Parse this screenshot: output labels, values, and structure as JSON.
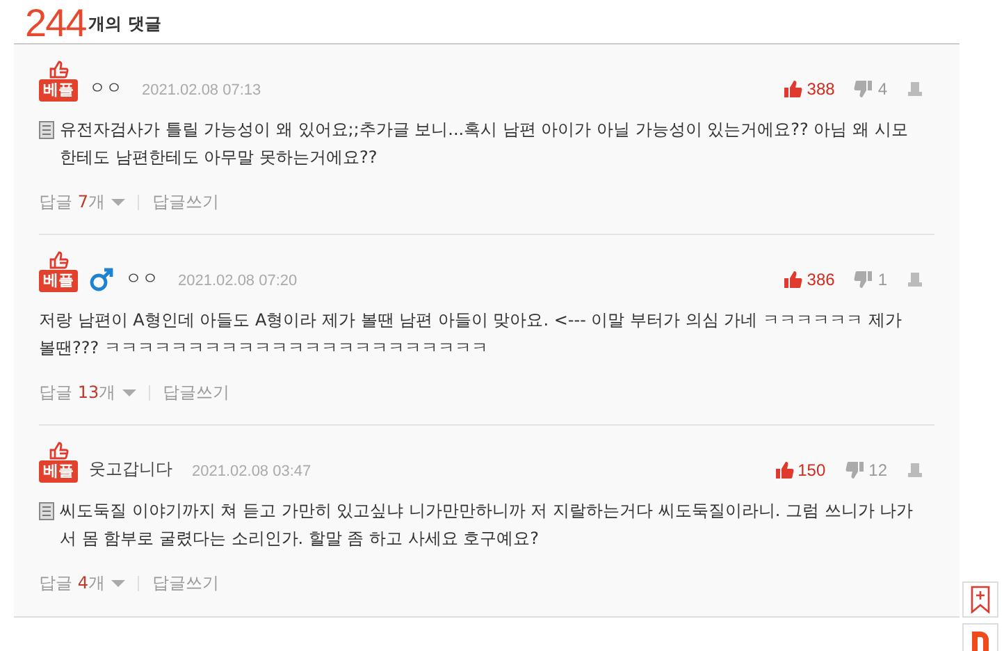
{
  "header": {
    "count": "244",
    "label": "개의 댓글"
  },
  "comments": [
    {
      "badge": "베플",
      "male": false,
      "author": "ㅇㅇ",
      "date": "2021.02.08 07:13",
      "likes": "388",
      "dislikes": "4",
      "memo_icon": true,
      "text": "유전자검사가 틀릴 가능성이 왜 있어요;;추가글 보니...혹시 남편 아이가 아닐 가능성이 있는거에요?? 아님 왜 시모한테도 남편한테도 아무말 못하는거에요??",
      "reply_label": "답글",
      "reply_count": "7",
      "reply_unit": "개",
      "write_label": "답글쓰기"
    },
    {
      "badge": "베플",
      "male": true,
      "author": "ㅇㅇ",
      "date": "2021.02.08 07:20",
      "likes": "386",
      "dislikes": "1",
      "memo_icon": false,
      "text": "저랑 남편이 A형인데 아들도 A형이라 제가 볼땐 남편 아들이 맞아요. <--- 이말 부터가 의심 가네 ㅋㅋㅋㅋㅋㅋ 제가볼땐??? ㅋㅋㅋㅋㅋㅋㅋㅋㅋㅋㅋㅋㅋㅋㅋㅋㅋㅋㅋㅋㅋㅋㅋ",
      "reply_label": "답글",
      "reply_count": "13",
      "reply_unit": "개",
      "write_label": "답글쓰기"
    },
    {
      "badge": "베플",
      "male": false,
      "author": "웃고갑니다",
      "date": "2021.02.08 03:47",
      "likes": "150",
      "dislikes": "12",
      "memo_icon": true,
      "text": "씨도둑질 이야기까지 쳐 듣고 가만히 있고싶냐 니가만만하니까 저 지랄하는거다 씨도둑질이라니. 그럼 쓰니가 나가서 몸 함부로 굴렸다는 소리인가. 할말 좀 하고 사세요 호구예요?",
      "reply_label": "답글",
      "reply_count": "4",
      "reply_unit": "개",
      "write_label": "답글쓰기"
    }
  ]
}
